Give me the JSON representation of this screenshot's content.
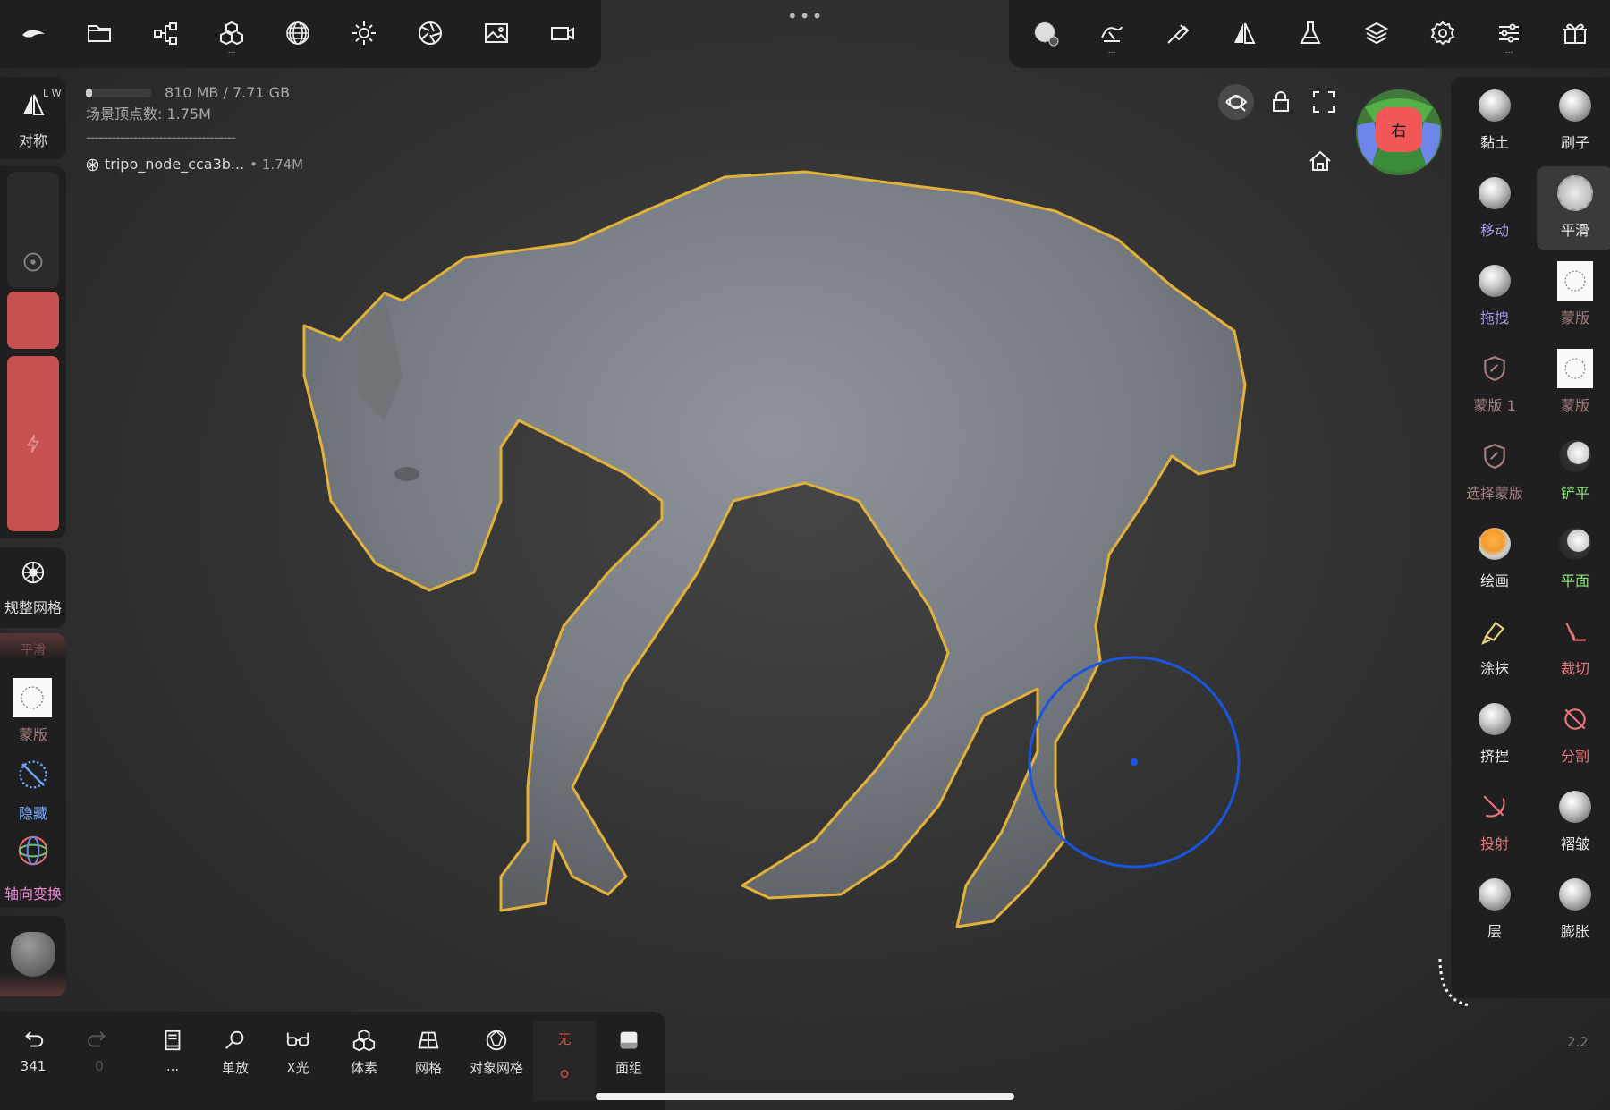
{
  "top_left_toolbar": [
    {
      "name": "logo-icon"
    },
    {
      "name": "folder-icon"
    },
    {
      "name": "share-nodes-icon"
    },
    {
      "name": "cubes-icon",
      "sub": "..."
    },
    {
      "name": "mesh-sphere-icon"
    },
    {
      "name": "sun-icon"
    },
    {
      "name": "aperture-icon"
    },
    {
      "name": "image-icon"
    },
    {
      "name": "video-camera-icon"
    }
  ],
  "top_dots": "•••",
  "top_right_toolbar": [
    {
      "name": "active-brush-icon"
    },
    {
      "name": "stroke-settings-icon",
      "sub": "..."
    },
    {
      "name": "paint-brush-icon"
    },
    {
      "name": "symmetry-icon"
    },
    {
      "name": "flask-icon"
    },
    {
      "name": "layers-icon"
    },
    {
      "name": "settings-gear-icon"
    },
    {
      "name": "sliders-icon",
      "sub": "..."
    },
    {
      "name": "gift-icon"
    }
  ],
  "info": {
    "memory": "810 MB / 7.71 GB",
    "memory_fraction": 0.1,
    "vertices": "场景顶点数: 1.75M",
    "dash_line": "-----------------------------------",
    "node_name": "tripo_node_cca3b...",
    "node_count": "• 1.74M"
  },
  "left_sidebar": {
    "symmetry_label": "对称",
    "symmetry_badge": "L W",
    "remesh_label": "规整网格",
    "smooth_header": "平滑",
    "mask_label": "蒙版",
    "hide_label": "隐藏",
    "gizmo_label": "轴向变换"
  },
  "viewport": {
    "cube_label": "右",
    "colors": {
      "outline": "#e2b13a",
      "cursor": "#1856e0",
      "slider": "#c75151"
    }
  },
  "tools": [
    {
      "label": "黏土",
      "color": "#e6e6e6",
      "icon": "ball"
    },
    {
      "label": "刷子",
      "color": "#e6e6e6",
      "icon": "ball"
    },
    {
      "label": "移动",
      "color": "#a99be8",
      "icon": "ball"
    },
    {
      "label": "平滑",
      "color": "#e6e6e6",
      "icon": "smooth",
      "selected": true
    },
    {
      "label": "拖拽",
      "color": "#a99be8",
      "icon": "ball"
    },
    {
      "label": "蒙版",
      "color": "#a67f7f",
      "icon": "mask"
    },
    {
      "label": "蒙版 1",
      "color": "#a67f7f",
      "icon": "shield"
    },
    {
      "label": "蒙版",
      "color": "#a67f7f",
      "icon": "mask"
    },
    {
      "label": "选择蒙版",
      "color": "#a67f7f",
      "icon": "shield"
    },
    {
      "label": "铲平",
      "color": "#8ee07a",
      "icon": "ball-dark"
    },
    {
      "label": "绘画",
      "color": "#e6e6e6",
      "icon": "ball-orange"
    },
    {
      "label": "平面",
      "color": "#8ee07a",
      "icon": "ball-dark"
    },
    {
      "label": "涂抹",
      "color": "#e6e6e6",
      "icon": "smudge"
    },
    {
      "label": "裁切",
      "color": "#e9777d",
      "icon": "trim"
    },
    {
      "label": "挤捏",
      "color": "#e6e6e6",
      "icon": "ball"
    },
    {
      "label": "分割",
      "color": "#e9777d",
      "icon": "split"
    },
    {
      "label": "投射",
      "color": "#e9777d",
      "icon": "project"
    },
    {
      "label": "褶皱",
      "color": "#e6e6e6",
      "icon": "ball"
    },
    {
      "label": "层",
      "color": "#e6e6e6",
      "icon": "ball"
    },
    {
      "label": "膨胀",
      "color": "#e6e6e6",
      "icon": "ball"
    }
  ],
  "bottom_bar": [
    {
      "name": "undo-icon",
      "label": "341"
    },
    {
      "name": "redo-icon",
      "label": "0"
    },
    {
      "name": "book-icon",
      "label": "..."
    },
    {
      "name": "magnify-icon",
      "label": "单放"
    },
    {
      "name": "xray-glasses-icon",
      "label": "X光"
    },
    {
      "name": "voxel-icon",
      "label": "体素"
    },
    {
      "name": "grid-icon",
      "label": "网格"
    },
    {
      "name": "object-mesh-icon",
      "label": "对象网格"
    },
    {
      "name": "none-icon",
      "label": "无"
    },
    {
      "name": "face-group-icon",
      "label": "面组"
    }
  ],
  "version": "2.2"
}
